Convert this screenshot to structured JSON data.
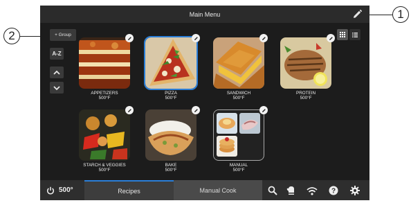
{
  "callouts": {
    "one": "1",
    "two": "2"
  },
  "header": {
    "title": "Main Menu",
    "edit_icon": "pencil-icon"
  },
  "toolbar": {
    "group_label": "+ Group",
    "sort_label": "A-Z",
    "up_icon": "chevron-up-icon",
    "down_icon": "chevron-down-icon",
    "grid_icon": "grid-view-icon",
    "list_icon": "list-view-icon"
  },
  "recipes": [
    {
      "name": "APPETIZERS",
      "temp": "500°F"
    },
    {
      "name": "PIZZA",
      "temp": "500°F",
      "selected": true
    },
    {
      "name": "SANDWICH",
      "temp": "500°F"
    },
    {
      "name": "PROTEIN",
      "temp": "500°F"
    },
    {
      "name": "STARCH & VEGGIES",
      "temp": "500°F"
    },
    {
      "name": "BAKE",
      "temp": "500°F"
    },
    {
      "name": "MANUAL",
      "temp": "500°F"
    }
  ],
  "bottom": {
    "power_icon": "power-icon",
    "temp": "500°",
    "tabs": [
      {
        "label": "Recipes",
        "active": true
      },
      {
        "label": "Manual Cook",
        "active": false
      }
    ],
    "icons": [
      "search-icon",
      "oven-mitt-icon",
      "wifi-icon",
      "help-icon",
      "settings-icon"
    ]
  },
  "colors": {
    "accent": "#2b7fd9",
    "background": "#1c1c1c",
    "topbar": "#2b2b2b"
  }
}
